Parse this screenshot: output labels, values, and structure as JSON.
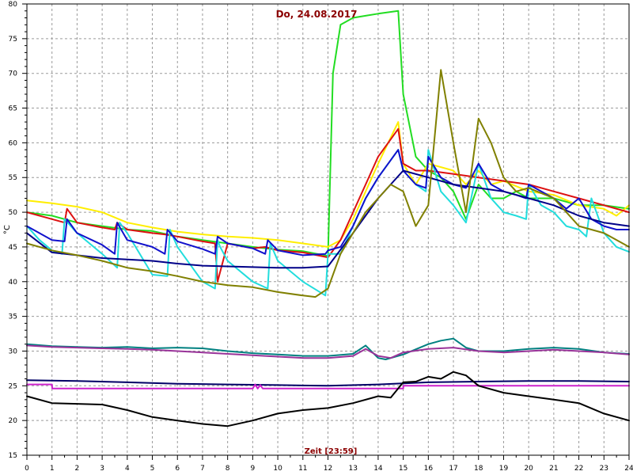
{
  "chart_data": {
    "type": "line",
    "title": "Do, 24.08.2017",
    "xlabel": "Zeit [23:59]",
    "ylabel": "°C",
    "xlim": [
      0,
      24
    ],
    "ylim": [
      15,
      80
    ],
    "x_ticks": [
      "0",
      "1",
      "2",
      "3",
      "4",
      "5",
      "6",
      "7",
      "8",
      "9",
      "10",
      "11",
      "12",
      "13",
      "14",
      "15",
      "16",
      "17",
      "18",
      "19",
      "20",
      "21",
      "22",
      "23",
      "24"
    ],
    "y_ticks": [
      "15",
      "20",
      "25",
      "30",
      "35",
      "40",
      "45",
      "50",
      "55",
      "60",
      "65",
      "70",
      "75",
      "80"
    ],
    "grid": true,
    "series": [
      {
        "color": "#22dd22",
        "x": [
          0,
          1,
          2,
          3,
          4,
          5,
          6,
          7,
          8,
          9,
          10,
          11,
          12,
          12.2,
          12.5,
          13,
          13.5,
          14,
          14.8,
          15,
          15.5,
          16,
          16.5,
          17,
          17.5,
          18,
          18.5,
          19,
          19.5,
          20,
          21,
          22,
          23,
          24
        ],
        "y": [
          50,
          49.5,
          48.5,
          48,
          47.5,
          47.3,
          46.5,
          46,
          45.5,
          45,
          44.6,
          44.4,
          43.7,
          70,
          77,
          78,
          78.3,
          78.6,
          79,
          67,
          58,
          56,
          55,
          53,
          49,
          54,
          52,
          52,
          53,
          52,
          52,
          51,
          51,
          50.5
        ]
      },
      {
        "color": "#ffee00",
        "x": [
          0,
          1,
          2,
          3,
          4,
          5,
          6,
          7,
          8,
          9,
          10,
          11,
          12,
          12.5,
          13,
          13.5,
          14,
          14.8,
          15,
          15.5,
          16,
          17,
          17.5,
          18,
          18.5,
          19,
          20,
          21,
          22,
          23,
          23.5,
          24
        ],
        "y": [
          51.7,
          51.3,
          50.8,
          50,
          48.5,
          47.8,
          47.2,
          46.8,
          46.5,
          46.3,
          46,
          45.5,
          45,
          46,
          49,
          53,
          57,
          63,
          57,
          54,
          57,
          56,
          54,
          56,
          54,
          54.5,
          53,
          52.5,
          51,
          50.5,
          49.5,
          51
        ]
      },
      {
        "color": "#dd1111",
        "x": [
          0,
          1,
          1.5,
          1.6,
          2,
          3,
          3.5,
          3.6,
          4,
          5,
          5.5,
          6,
          7,
          7.5,
          7.6,
          8,
          9,
          9.5,
          10,
          11,
          12,
          12.5,
          13,
          13.5,
          14,
          14.8,
          15,
          15.5,
          16,
          17,
          18,
          19,
          20,
          21,
          22,
          23,
          24
        ],
        "y": [
          50,
          49,
          48.5,
          50.5,
          48.5,
          47.8,
          47.5,
          48.5,
          47.5,
          47,
          46.8,
          46.5,
          45.8,
          45.5,
          40,
          45.5,
          44.8,
          45,
          44.5,
          44.2,
          43.5,
          46,
          50,
          54,
          58,
          62,
          57,
          56,
          56,
          55.5,
          55,
          54.5,
          54,
          53,
          52,
          51,
          50
        ]
      },
      {
        "color": "#22dddd",
        "x": [
          0,
          0.5,
          1,
          1.4,
          1.5,
          2,
          3,
          3.6,
          3.7,
          4,
          5,
          5.6,
          5.7,
          6,
          7,
          7.5,
          7.6,
          7.7,
          8,
          9,
          9.6,
          9.7,
          10,
          11,
          11.9,
          12,
          12.5,
          13,
          13.5,
          14,
          14.8,
          15,
          15.5,
          15.9,
          16,
          16.5,
          17,
          17.5,
          18,
          18.5,
          19,
          19.5,
          19.9,
          20,
          20.5,
          21,
          21.5,
          22,
          22.3,
          22.5,
          23,
          23.5,
          24
        ],
        "y": [
          48,
          46,
          44.5,
          44,
          49,
          47,
          44,
          42,
          48.5,
          47,
          41,
          40.8,
          47.5,
          45,
          40,
          39,
          46,
          45,
          43,
          40,
          39,
          45.5,
          43,
          40,
          38,
          44,
          44,
          48,
          52,
          55,
          59,
          56,
          54,
          53,
          59,
          53,
          51,
          48.5,
          57,
          52,
          50,
          49.5,
          49,
          54,
          51,
          50,
          48,
          47.5,
          46.5,
          52,
          47,
          45,
          44.3
        ]
      },
      {
        "color": "#1111cc",
        "x": [
          0,
          1,
          1.5,
          1.6,
          2,
          3,
          3.5,
          3.6,
          4,
          5,
          5.5,
          5.6,
          6,
          7,
          7.5,
          7.6,
          8,
          9,
          9.5,
          9.6,
          10,
          11,
          11.9,
          12,
          12.5,
          13,
          13.5,
          14,
          14.8,
          15,
          15.5,
          15.9,
          16,
          16.5,
          17,
          17.5,
          18,
          18.5,
          19,
          19.5,
          19.9,
          20,
          21,
          21.5,
          22,
          22.5,
          23,
          23.5,
          24
        ],
        "y": [
          48,
          46,
          45.8,
          49,
          47,
          45.3,
          44,
          48.5,
          46,
          45,
          44,
          47.5,
          45.8,
          44.7,
          44,
          46.5,
          45.5,
          44.8,
          44,
          46,
          44.5,
          43.8,
          44,
          44.5,
          45,
          48,
          52,
          55,
          59,
          56,
          54,
          53.5,
          58,
          55,
          54,
          53.5,
          57,
          54,
          53,
          52.5,
          52,
          54,
          52,
          50.5,
          52,
          49,
          48,
          47.5,
          47.5
        ]
      },
      {
        "color": "#000088",
        "x": [
          0,
          1,
          2,
          3,
          4,
          5,
          6,
          7,
          8,
          9,
          10,
          11,
          12,
          13,
          14,
          15,
          16,
          17,
          18,
          19,
          20,
          21,
          22,
          23,
          24
        ],
        "y": [
          47,
          44.2,
          43.8,
          43.4,
          43.2,
          43,
          42.6,
          42.3,
          42.2,
          42.1,
          42,
          42,
          42.2,
          47,
          52,
          56,
          55,
          54,
          53.5,
          53,
          52,
          51,
          49.5,
          48.5,
          48
        ]
      },
      {
        "color": "#808000",
        "x": [
          0,
          1,
          2,
          3,
          4,
          5,
          6,
          7,
          8,
          9,
          10,
          11,
          11.5,
          12,
          12.5,
          13,
          13.5,
          14,
          14.5,
          15,
          15.5,
          16,
          16.5,
          17,
          17.5,
          18,
          18.5,
          19,
          19.5,
          20,
          21,
          22,
          23,
          24
        ],
        "y": [
          45.5,
          44.5,
          43.8,
          43,
          42,
          41.5,
          40.8,
          40,
          39.5,
          39.2,
          38.5,
          38,
          37.8,
          39,
          44,
          47,
          50,
          52,
          54,
          53,
          48,
          51,
          70.5,
          60,
          50,
          63.5,
          60,
          55,
          53,
          53.5,
          52,
          48,
          47,
          45
        ]
      },
      {
        "color": "#008080",
        "x": [
          0,
          1,
          2,
          3,
          4,
          5,
          6,
          7,
          8,
          9,
          10,
          11,
          12,
          13,
          13.5,
          14,
          14.3,
          15,
          16,
          16.5,
          17,
          17.5,
          18,
          19,
          20,
          21,
          22,
          23,
          24
        ],
        "y": [
          31,
          30.7,
          30.6,
          30.5,
          30.6,
          30.4,
          30.5,
          30.4,
          30,
          29.7,
          29.5,
          29.3,
          29.3,
          29.6,
          30.8,
          29,
          28.8,
          29.5,
          31,
          31.5,
          31.8,
          30.5,
          30,
          30,
          30.3,
          30.5,
          30.3,
          29.8,
          29.6
        ]
      },
      {
        "color": "#993399",
        "x": [
          0,
          1,
          2,
          3,
          4,
          5,
          6,
          7,
          8,
          9,
          10,
          11,
          12,
          13,
          13.5,
          14,
          14.5,
          15,
          16,
          17,
          18,
          19,
          20,
          21,
          22,
          23,
          24
        ],
        "y": [
          30.8,
          30.6,
          30.5,
          30.4,
          30.3,
          30.2,
          30,
          29.8,
          29.6,
          29.4,
          29.2,
          29,
          29,
          29.3,
          30.3,
          29.3,
          29,
          29.8,
          30.3,
          30.5,
          30,
          29.8,
          30,
          30.2,
          30,
          29.8,
          29.5
        ]
      },
      {
        "color": "#000066",
        "x": [
          0,
          2,
          4,
          6,
          8,
          10,
          12,
          14,
          16,
          18,
          20,
          22,
          24
        ],
        "y": [
          25.8,
          25.7,
          25.5,
          25.3,
          25.2,
          25.1,
          25,
          25.2,
          25.5,
          25.6,
          25.7,
          25.7,
          25.6
        ]
      },
      {
        "color": "#cc22cc",
        "x": [
          0,
          1,
          1.01,
          9,
          9.1,
          9.2,
          9.3,
          9.4,
          15,
          15.01,
          24
        ],
        "y": [
          25.2,
          25.2,
          24.6,
          24.6,
          25.2,
          24.6,
          25.1,
          24.6,
          24.6,
          25,
          25
        ]
      },
      {
        "color": "#000000",
        "x": [
          0,
          1,
          2,
          3,
          4,
          5,
          6,
          7,
          8,
          9,
          10,
          11,
          12,
          13,
          14,
          14.5,
          15,
          15.5,
          16,
          16.5,
          17,
          17.5,
          18,
          19,
          20,
          21,
          22,
          23,
          24
        ],
        "y": [
          23.5,
          22.5,
          22.4,
          22.3,
          21.5,
          20.5,
          20,
          19.5,
          19.2,
          20,
          21,
          21.5,
          21.8,
          22.5,
          23.5,
          23.3,
          25.5,
          25.6,
          26.3,
          26,
          27,
          26.5,
          25,
          24,
          23.5,
          23,
          22.5,
          21,
          20
        ]
      }
    ]
  }
}
